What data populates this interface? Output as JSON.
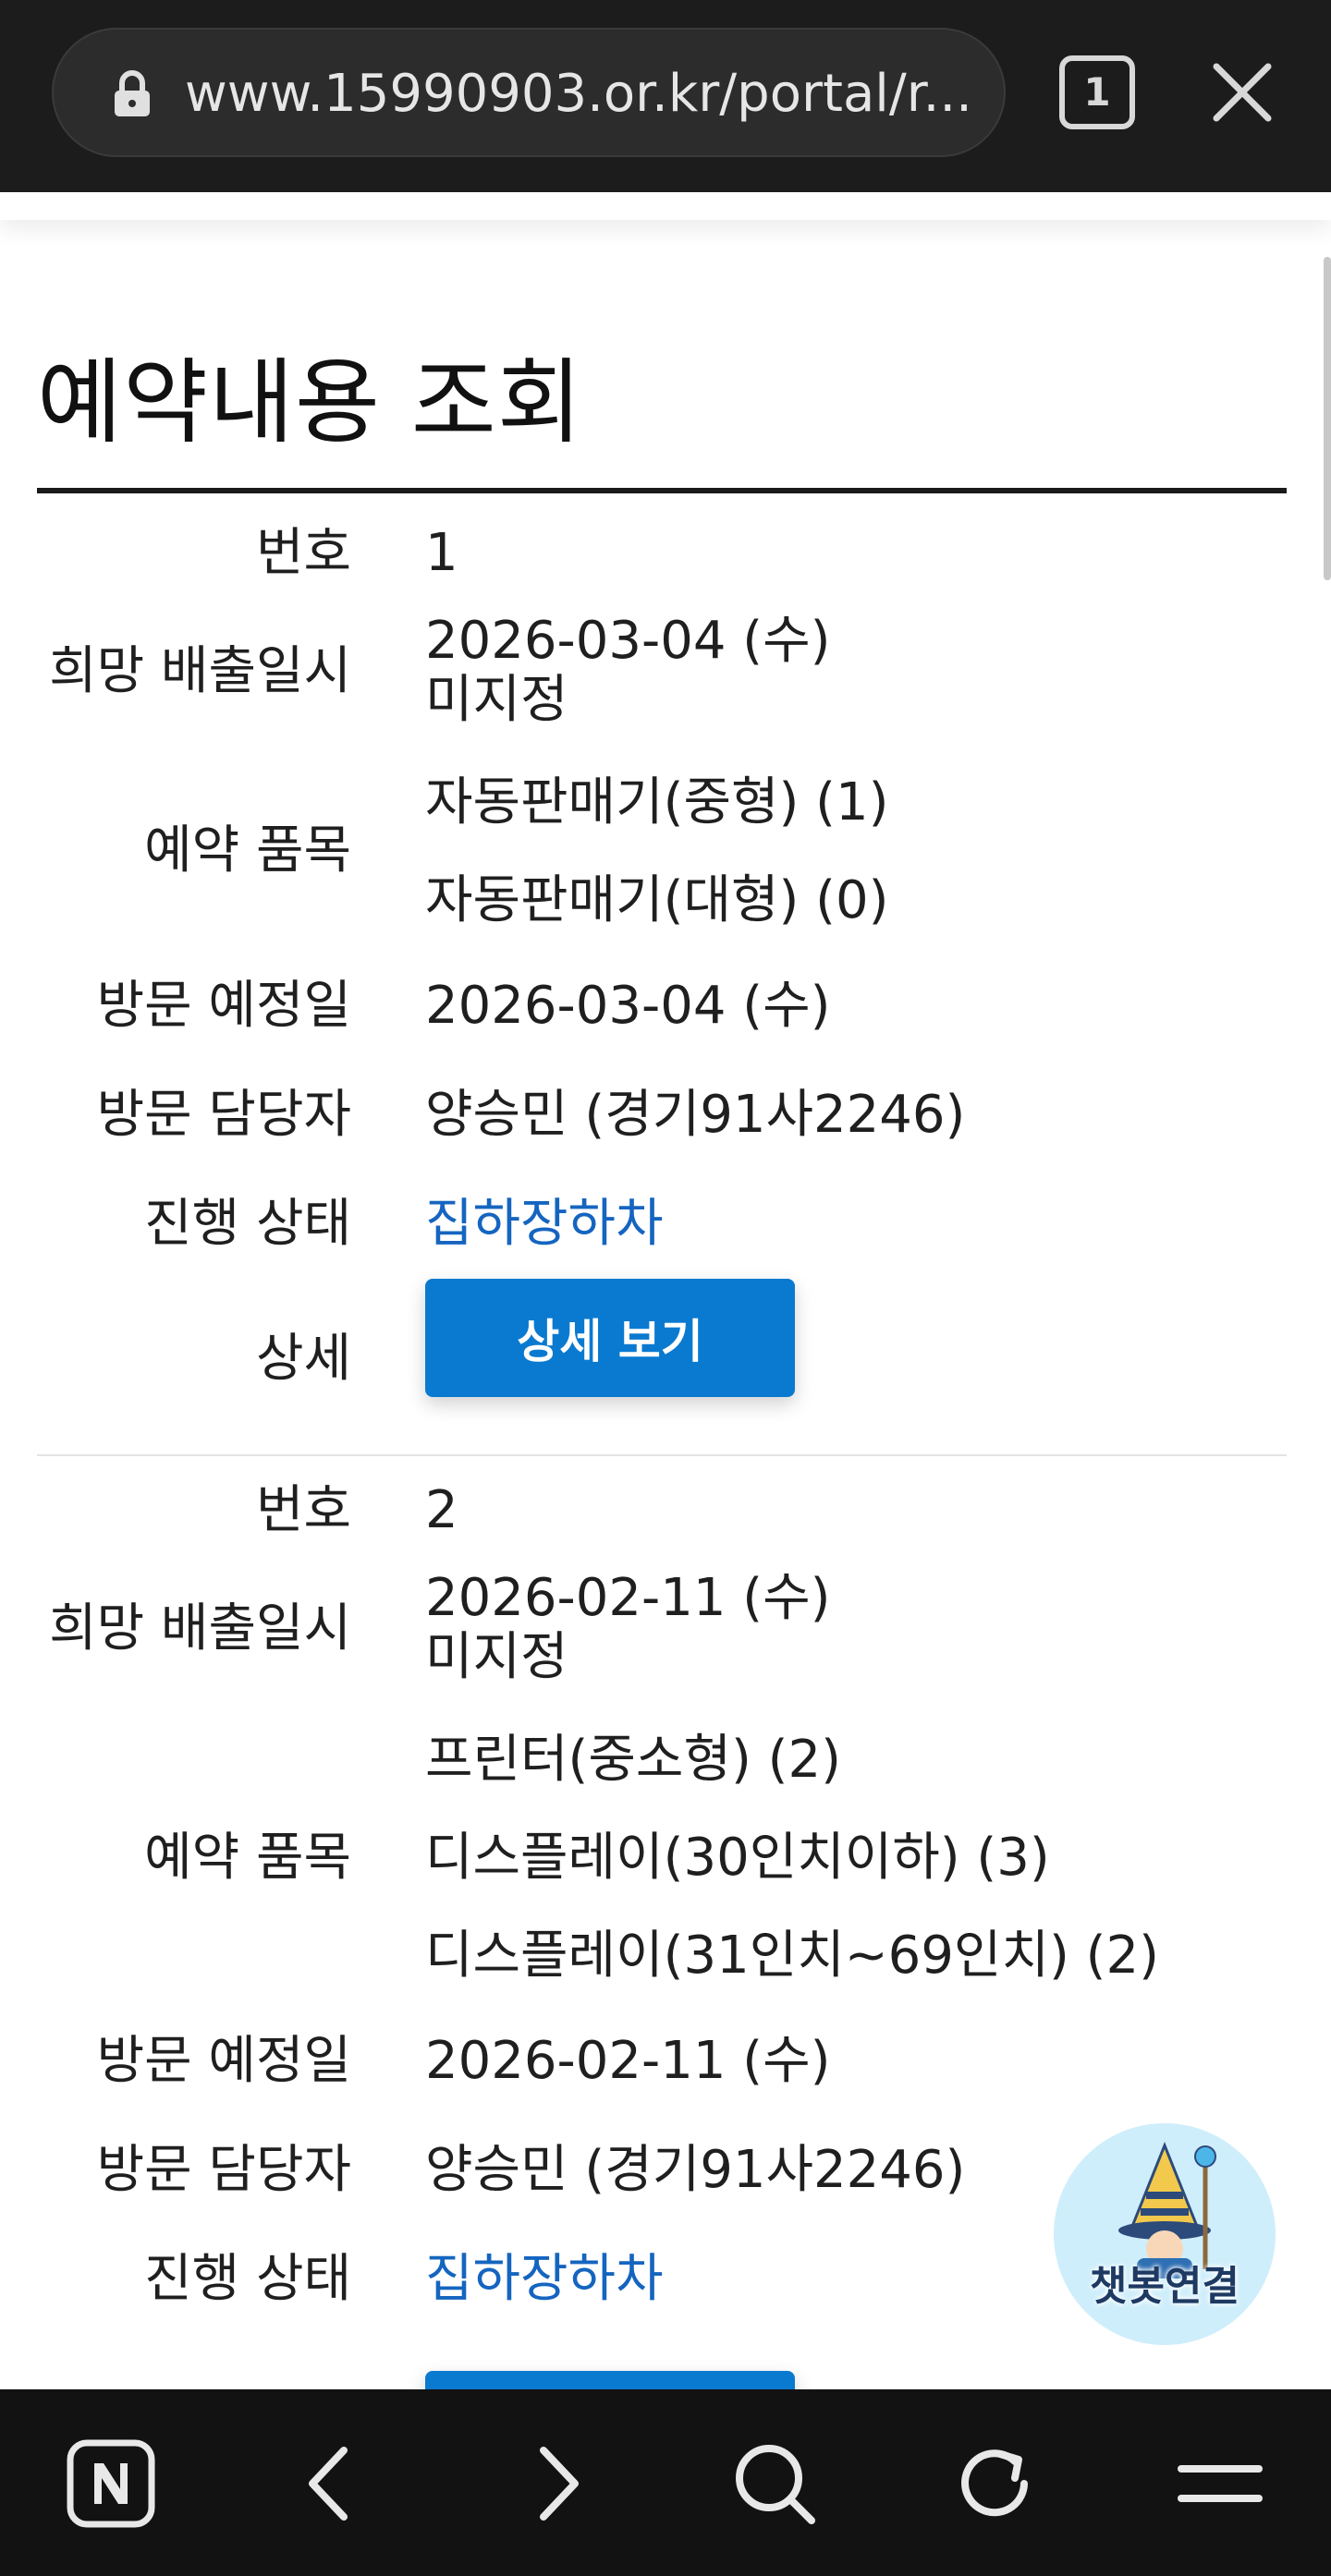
{
  "browser": {
    "url": "www.15990903.or.kr/portal/r...",
    "tab_count": "1"
  },
  "page": {
    "title": "예약내용 조회"
  },
  "records": [
    {
      "number_label": "번호",
      "number": "1",
      "desired_date_label": "희망 배출일시",
      "desired_date": "2026-03-04 (수)",
      "desired_time": "미지정",
      "items_label": "예약 품목",
      "items": [
        "자동판매기(중형) (1)",
        "자동판매기(대형) (0)"
      ],
      "visit_date_label": "방문 예정일",
      "visit_date": "2026-03-04 (수)",
      "visitor_label": "방문 담당자",
      "visitor": "양승민 (경기91사2246)",
      "status_label": "진행 상태",
      "status": "집하장하차",
      "detail_label": "상세",
      "detail_button": "상세 보기"
    },
    {
      "number_label": "번호",
      "number": "2",
      "desired_date_label": "희망 배출일시",
      "desired_date": "2026-02-11 (수)",
      "desired_time": "미지정",
      "items_label": "예약 품목",
      "items": [
        "프린터(중소형) (2)",
        "디스플레이(30인치이하) (3)",
        "디스플레이(31인치~69인치) (2)"
      ],
      "visit_date_label": "방문 예정일",
      "visit_date": "2026-02-11 (수)",
      "visitor_label": "방문 담당자",
      "visitor": "양승민 (경기91사2246)",
      "status_label": "진행 상태",
      "status": "집하장하차"
    }
  ],
  "chatbot": {
    "label": "챗봇연결"
  },
  "colors": {
    "accent_button": "#0a7ad0",
    "status_link": "#1565c0",
    "browser_chrome": "#1c1c1c"
  },
  "icons": {
    "lock": "lock-icon",
    "close": "close-icon",
    "naver": "naver-icon",
    "back": "back-arrow-icon",
    "forward": "forward-arrow-icon",
    "search": "search-icon",
    "reload": "reload-icon",
    "menu": "menu-icon"
  }
}
